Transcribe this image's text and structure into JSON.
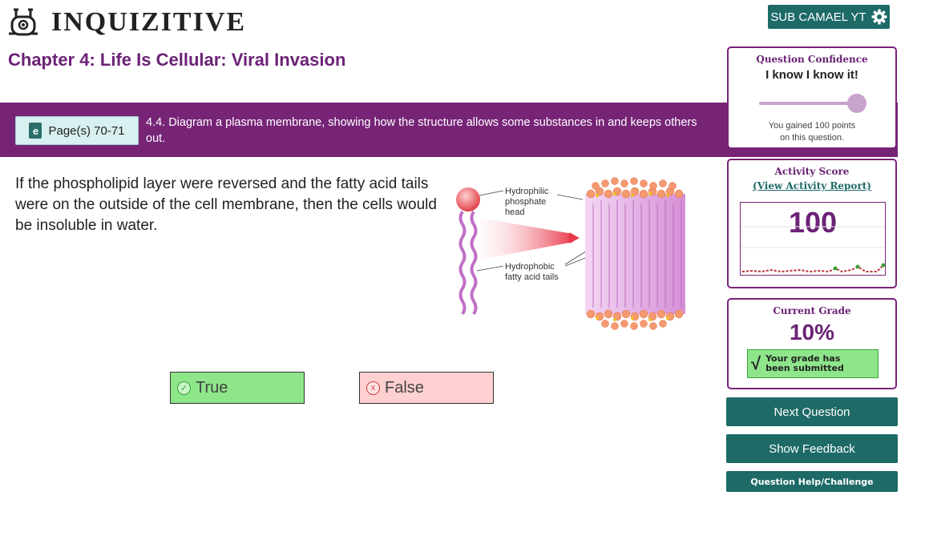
{
  "app": {
    "logo_text": "INQUIZITIVE",
    "accent_color": "#772477",
    "teal_color": "#1d6a67"
  },
  "header": {
    "user_button_label": "SUB CAMAEL YT",
    "user_icon": "gear-icon"
  },
  "chapter": {
    "title": "Chapter 4: Life Is Cellular: Viral Invasion"
  },
  "objective": {
    "pages_label": "Page(s) 70-71",
    "ebook_icon_letter": "e",
    "text": "4.4. Diagram a plasma membrane, showing how the structure allows some substances in and keeps others out."
  },
  "question": {
    "text": "If the phospholipid layer were reversed and the fatty acid tails were on the outside of the cell membrane, then the cells would be insoluble in water.",
    "diagram_labels": {
      "head_line1": "Hydrophilic",
      "head_line2": "phosphate",
      "head_line3": "head",
      "tail_line1": "Hydrophobic",
      "tail_line2": "fatty acid tails"
    }
  },
  "answers": {
    "true_label": "True",
    "true_icon": "check-circle-icon",
    "true_color": "#8ee58a",
    "false_label": "False",
    "false_icon": "x-circle-icon",
    "false_color": "#ffd0d0"
  },
  "confidence": {
    "title": "Question Confidence",
    "value": "I know I know it!",
    "slider_fraction": 1.0,
    "note_line1": "You gained 100 points",
    "note_line2": "on this question."
  },
  "activity": {
    "title": "Activity Score",
    "report_link": "(View Activity Report)",
    "score": "100"
  },
  "grade": {
    "title": "Current Grade",
    "value": "10%",
    "submitted_line1": "Your grade has",
    "submitted_line2": "been submitted"
  },
  "actions": {
    "next_label": "Next Question",
    "feedback_label": "Show Feedback",
    "help_label": "Question Help/Challenge"
  }
}
